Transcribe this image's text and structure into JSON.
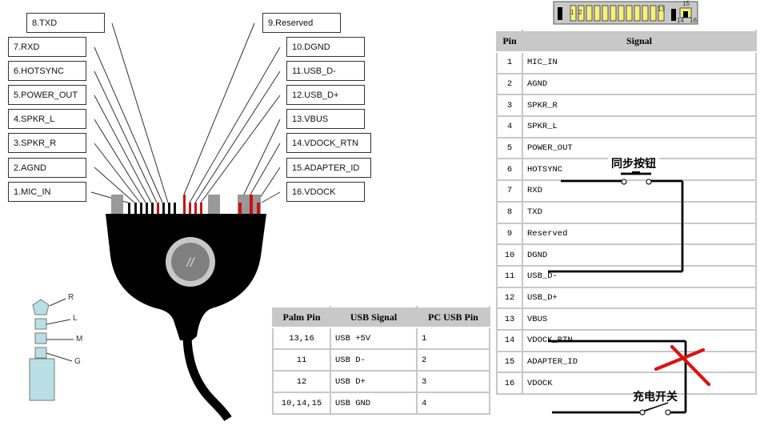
{
  "left_labels": [
    "8.TXD",
    "7.RXD",
    "6.HOTSYNC",
    "5.POWER_OUT",
    "4.SPKR_L",
    "3.SPKR_R",
    "2.AGND",
    "1.MIC_IN"
  ],
  "right_labels": [
    "9.Reserved",
    "10.DGND",
    "11.USB_D-",
    "12.USB_D+",
    "13.VBUS",
    "14.VDOCK_RTN",
    "15.ADAPTER_ID",
    "16.VDOCK"
  ],
  "connector_icon": {
    "labels": [
      "1",
      "2",
      "13",
      "15",
      "14",
      "16"
    ]
  },
  "cable_logo": "//",
  "jack": {
    "labels": [
      "R",
      "L",
      "M",
      "G"
    ]
  },
  "pin_table": {
    "headers": [
      "Pin",
      "Signal"
    ],
    "rows": [
      [
        "1",
        "MIC_IN"
      ],
      [
        "2",
        "AGND"
      ],
      [
        "3",
        "SPKR_R"
      ],
      [
        "4",
        "SPKR_L"
      ],
      [
        "5",
        "POWER_OUT"
      ],
      [
        "6",
        "HOTSYNC"
      ],
      [
        "7",
        "RXD"
      ],
      [
        "8",
        "TXD"
      ],
      [
        "9",
        "Reserved"
      ],
      [
        "10",
        "DGND"
      ],
      [
        "11",
        "USB_D-"
      ],
      [
        "12",
        "USB_D+"
      ],
      [
        "13",
        "VBUS"
      ],
      [
        "14",
        "VDOCK_RTN"
      ],
      [
        "15",
        "ADAPTER_ID"
      ],
      [
        "16",
        "VDOCK"
      ]
    ]
  },
  "usb_table": {
    "headers": [
      "Palm Pin",
      "USB Signal",
      "PC USB Pin"
    ],
    "rows": [
      [
        "13,16",
        "USB +5V",
        "1"
      ],
      [
        "11",
        "USB D-",
        "2"
      ],
      [
        "12",
        "USB D+",
        "3"
      ],
      [
        "10,14,15",
        "USB GND",
        "4"
      ]
    ]
  },
  "annotations": {
    "hotsync_button": "同步按钮",
    "charge_switch": "充电开关"
  },
  "colors": {
    "pin_red": "#cc1111",
    "pin_yellow": "#f5f07a",
    "cross": "#e01010",
    "jack": "#b8e0e4"
  }
}
